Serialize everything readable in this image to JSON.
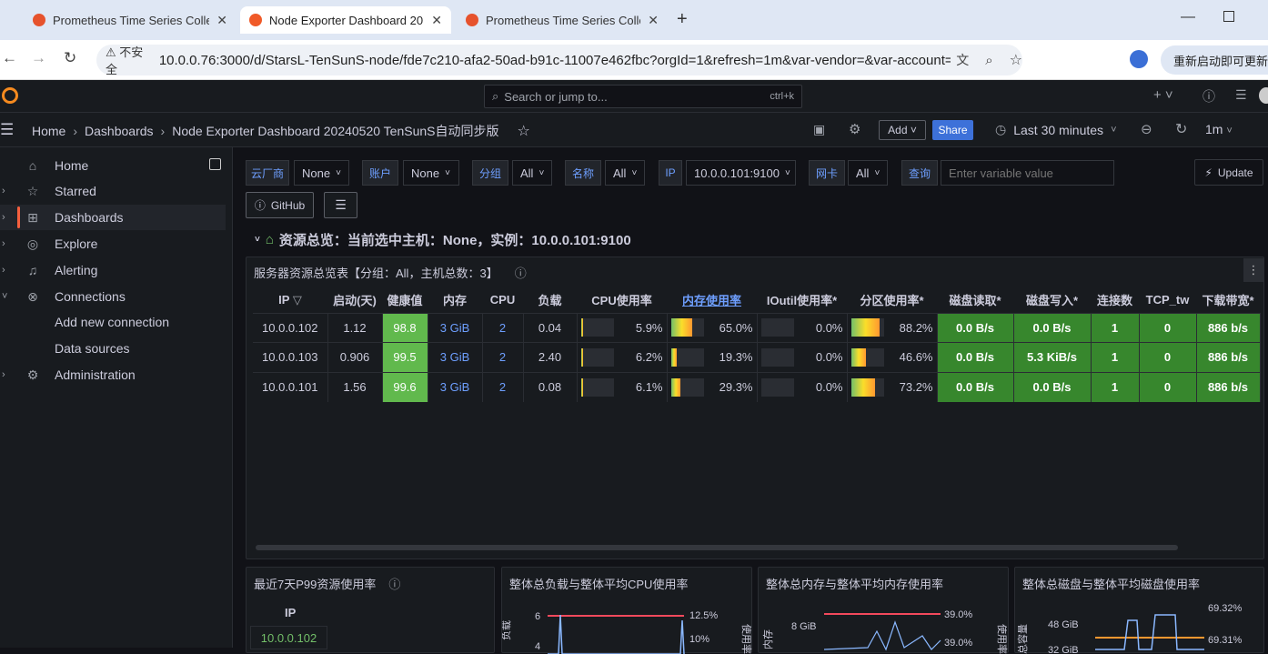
{
  "browser": {
    "tabs": [
      {
        "title": "Prometheus Time Series Colle",
        "active": false
      },
      {
        "title": "Node Exporter Dashboard 20",
        "active": true
      },
      {
        "title": "Prometheus Time Series Colle",
        "active": false
      }
    ],
    "insecure_label": "不安全",
    "url": "10.0.0.76:3000/d/StarsL-TenSunS-node/fde7c210-afa2-50ad-b91c-11007e462fbc?orgId=1&refresh=1m&var-vendor=&var-account=&var...",
    "relaunch_label": "重新启动即可更新"
  },
  "grafana": {
    "search_placeholder": "Search or jump to...",
    "search_shortcut": "ctrl+k",
    "breadcrumb": [
      "Home",
      "Dashboards",
      "Node Exporter Dashboard 20240520 TenSunS自动同步版"
    ],
    "toolbar": {
      "add": "Add",
      "share": "Share",
      "time_range": "Last 30 minutes",
      "refresh": "1m"
    }
  },
  "sidebar": {
    "items": [
      {
        "label": "Home",
        "icon": "home-icon"
      },
      {
        "label": "Starred",
        "icon": "star-icon"
      },
      {
        "label": "Dashboards",
        "icon": "apps-icon"
      },
      {
        "label": "Explore",
        "icon": "compass-icon"
      },
      {
        "label": "Alerting",
        "icon": "bell-icon"
      },
      {
        "label": "Connections",
        "icon": "link-icon"
      },
      {
        "label": "Add new connection",
        "icon": ""
      },
      {
        "label": "Data sources",
        "icon": ""
      },
      {
        "label": "Administration",
        "icon": "cog-icon"
      }
    ]
  },
  "variables": {
    "vendor": {
      "label": "云厂商",
      "value": "None"
    },
    "account": {
      "label": "账户",
      "value": "None"
    },
    "group": {
      "label": "分组",
      "value": "All"
    },
    "name": {
      "label": "名称",
      "value": "All"
    },
    "ip": {
      "label": "IP",
      "value": "10.0.0.101:9100"
    },
    "nic": {
      "label": "网卡",
      "value": "All"
    },
    "query": {
      "label": "查询",
      "placeholder": "Enter variable value"
    },
    "update": "Update",
    "github": "GitHub"
  },
  "row_title": "资源总览：当前选中主机：None，实例：10.0.0.101:9100",
  "server_panel": {
    "title": "服务器资源总览表【分组：All，主机总数：3】",
    "columns": [
      "IP",
      "启动(天)",
      "健康值",
      "内存",
      "CPU",
      "负载",
      "CPU使用率",
      "内存使用率",
      "IOutil使用率*",
      "分区使用率*",
      "磁盘读取*",
      "磁盘写入*",
      "连接数",
      "TCP_tw",
      "下载带宽*"
    ],
    "rows": [
      {
        "ip": "10.0.0.102",
        "uptime": "1.12",
        "health": "98.8",
        "mem": "3 GiB",
        "cpu": "2",
        "load": "0.04",
        "cpu_pct": "5.9%",
        "cpu_frac": 0.059,
        "mem_pct": "65.0%",
        "mem_frac": 0.65,
        "io_pct": "0.0%",
        "io_frac": 0,
        "part_pct": "88.2%",
        "part_frac": 0.882,
        "read": "0.0 B/s",
        "write": "0.0 B/s",
        "conn": "1",
        "tcptw": "0",
        "down": "886 b/s"
      },
      {
        "ip": "10.0.0.103",
        "uptime": "0.906",
        "health": "99.5",
        "mem": "3 GiB",
        "cpu": "2",
        "load": "2.40",
        "cpu_pct": "6.2%",
        "cpu_frac": 0.062,
        "mem_pct": "19.3%",
        "mem_frac": 0.193,
        "io_pct": "0.0%",
        "io_frac": 0,
        "part_pct": "46.6%",
        "part_frac": 0.466,
        "read": "0.0 B/s",
        "write": "5.3 KiB/s",
        "conn": "1",
        "tcptw": "0",
        "down": "886 b/s"
      },
      {
        "ip": "10.0.0.101",
        "uptime": "1.56",
        "health": "99.6",
        "mem": "3 GiB",
        "cpu": "2",
        "load": "0.08",
        "cpu_pct": "6.1%",
        "cpu_frac": 0.061,
        "mem_pct": "29.3%",
        "mem_frac": 0.293,
        "io_pct": "0.0%",
        "io_frac": 0,
        "part_pct": "73.2%",
        "part_frac": 0.732,
        "read": "0.0 B/s",
        "write": "0.0 B/s",
        "conn": "1",
        "tcptw": "0",
        "down": "886 b/s"
      }
    ]
  },
  "bottom_panels": {
    "p99": {
      "title": "最近7天P99资源使用率",
      "col": "IP",
      "first_ip": "10.0.0.102"
    },
    "load_cpu": {
      "title": "整体总负载与整体平均CPU使用率",
      "y_left": [
        "6",
        "4"
      ],
      "y_right": [
        "12.5%",
        "10%"
      ],
      "left_label": "负载",
      "right_label": "使用率"
    },
    "mem": {
      "title": "整体总内存与整体平均内存使用率",
      "y_left": [
        "8 GiB"
      ],
      "y_right": [
        "39.0%",
        "39.0%"
      ],
      "left_label": "内存",
      "right_label": "使用率"
    },
    "disk": {
      "title": "整体总磁盘与整体平均磁盘使用率",
      "y_left": [
        "48 GiB",
        "32 GiB"
      ],
      "y_right": [
        "69.32%",
        "69.31%"
      ],
      "left_label": "总容量",
      "right_label": "使用率"
    }
  }
}
